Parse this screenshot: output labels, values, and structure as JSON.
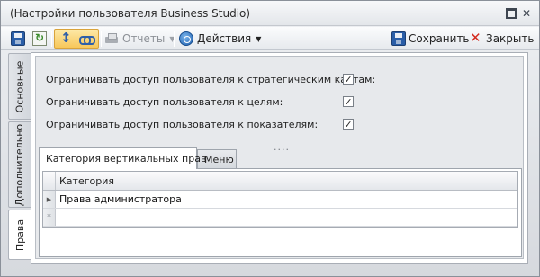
{
  "window": {
    "title": "(Настройки пользователя Business Studio)"
  },
  "toolbar": {
    "reports_label": "Отчеты",
    "actions_label": "Действия",
    "save_label": "Сохранить",
    "close_label": "Закрыть"
  },
  "side_tabs": {
    "basic": "Основные",
    "extra": "Дополнительно",
    "rights": "Права",
    "active": "rights"
  },
  "options": [
    {
      "label": "Ограничивать доступ пользователя к стратегическим картам:",
      "checked": true
    },
    {
      "label": "Ограничивать доступ пользователя к целям:",
      "checked": true
    },
    {
      "label": "Ограничивать доступ пользователя к показателям:",
      "checked": true
    }
  ],
  "splitter": "....",
  "tabs": {
    "category": "Категория вертикальных прав",
    "menu": "Меню",
    "active": "category"
  },
  "grid": {
    "column_header": "Категория",
    "rows": [
      "Права администратора"
    ],
    "new_row_marker": "*"
  },
  "colors": {
    "accent_toggle": "#f7c75a",
    "close_red": "#d42a1e",
    "icon_blue": "#2f5fa8"
  }
}
